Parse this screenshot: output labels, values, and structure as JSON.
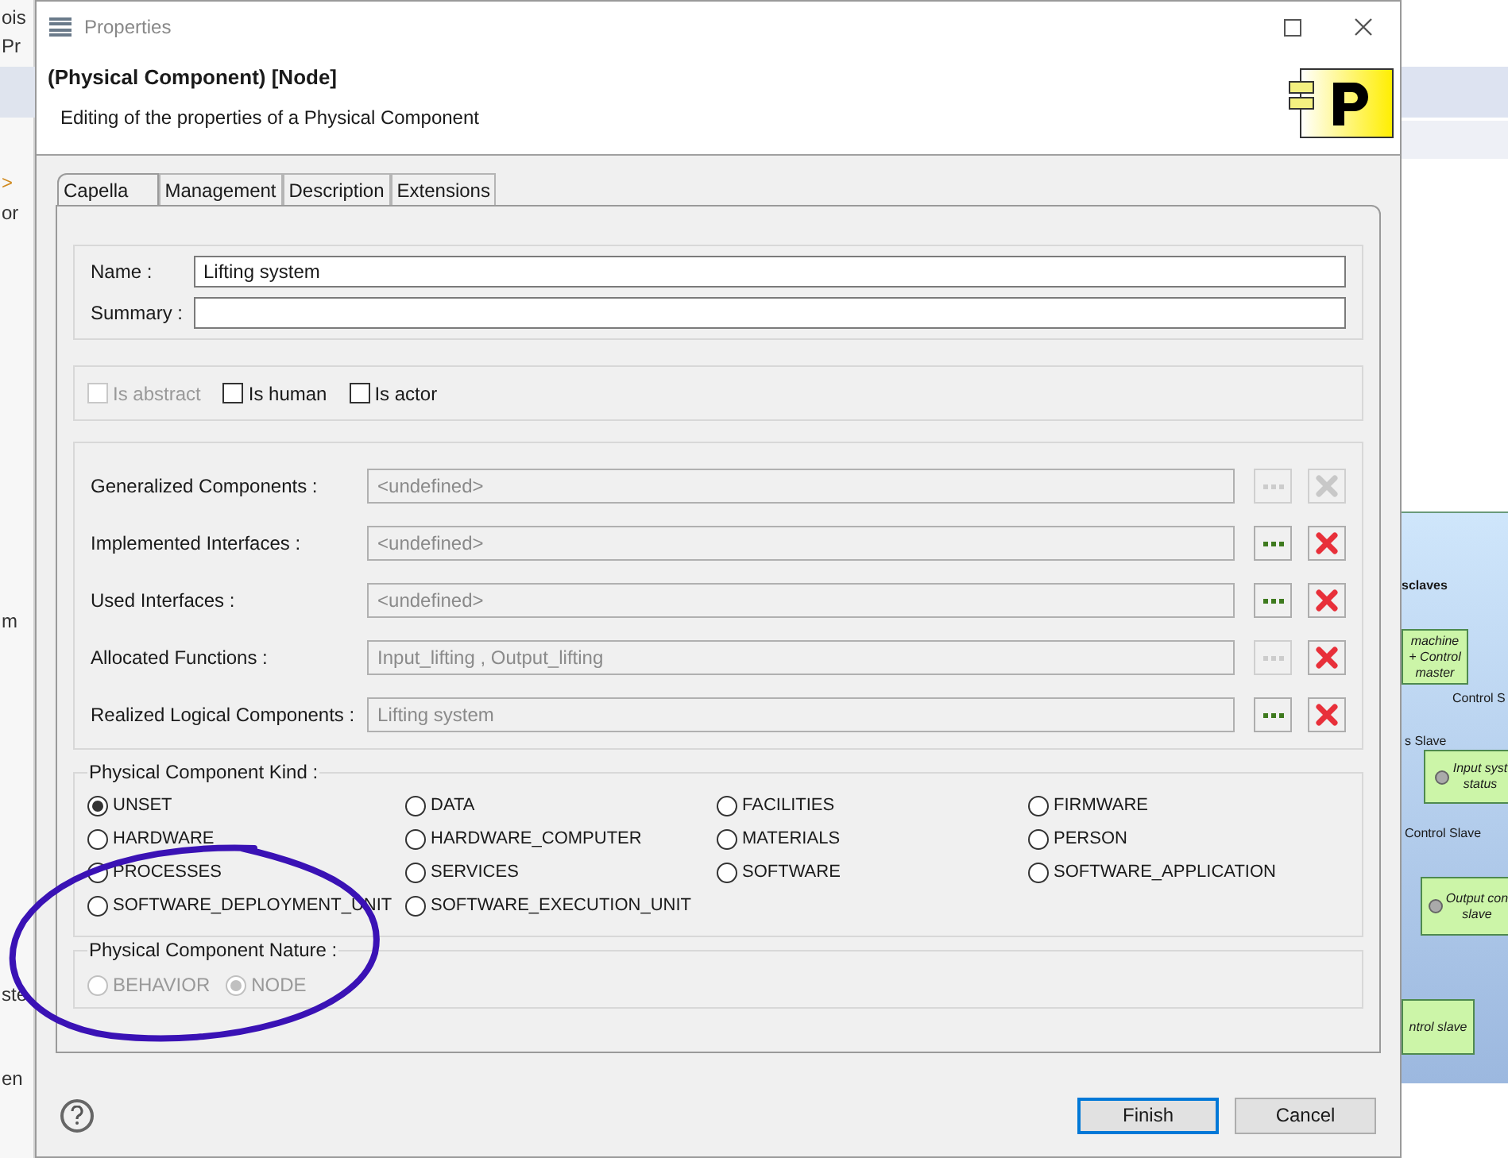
{
  "background_app": {
    "left_fragments": [
      "ois",
      "Pr",
      ">",
      "or",
      "m",
      "ste",
      "en"
    ],
    "diagram": {
      "container_title": "sclaves",
      "nodes": [
        {
          "lines": [
            "machine",
            "+ Control",
            "master"
          ],
          "kind": "plain"
        },
        {
          "lines": [
            "Input syst",
            "status"
          ],
          "kind": "function"
        },
        {
          "lines": [
            "Output con",
            "slave"
          ],
          "kind": "function"
        },
        {
          "lines": [
            "ntrol slave"
          ],
          "kind": "plain"
        }
      ],
      "labels": [
        "Control S",
        "s Slave",
        "Control Slave"
      ]
    }
  },
  "dialog": {
    "title": "Properties",
    "header_title": "(Physical Component) [Node]",
    "header_subtitle": "Editing of the properties of a Physical Component",
    "tabs": [
      {
        "label": "Capella",
        "selected": true
      },
      {
        "label": "Management",
        "selected": false
      },
      {
        "label": "Description",
        "selected": false
      },
      {
        "label": "Extensions",
        "selected": false
      }
    ],
    "fields": [
      {
        "label": "Name :",
        "value": "Lifting system"
      },
      {
        "label": "Summary :"
      }
    ],
    "flags": [
      {
        "label": "Is abstract",
        "checked": false,
        "disabled": true
      },
      {
        "label": "Is human",
        "checked": false,
        "disabled": false
      },
      {
        "label": "Is actor",
        "checked": false,
        "disabled": false
      }
    ],
    "references": [
      {
        "label": "Generalized Components :",
        "value": "<undefined>",
        "browse_enabled": false,
        "remove_enabled": false
      },
      {
        "label": "Implemented Interfaces :",
        "value": "<undefined>",
        "browse_enabled": true,
        "remove_enabled": true
      },
      {
        "label": "Used Interfaces :",
        "value": "<undefined>",
        "browse_enabled": true,
        "remove_enabled": true
      },
      {
        "label": "Allocated Functions :",
        "value": "Input_lifting , Output_lifting",
        "browse_enabled": false,
        "remove_enabled": true
      },
      {
        "label": "Realized Logical Components :",
        "value": "Lifting system",
        "browse_enabled": true,
        "remove_enabled": true
      }
    ],
    "kind_group": {
      "title": "Physical Component Kind :",
      "options": [
        {
          "label": "UNSET",
          "selected": true
        },
        {
          "label": "DATA",
          "selected": false
        },
        {
          "label": "FACILITIES",
          "selected": false
        },
        {
          "label": "FIRMWARE",
          "selected": false
        },
        {
          "label": "HARDWARE",
          "selected": false
        },
        {
          "label": "HARDWARE_COMPUTER",
          "selected": false
        },
        {
          "label": "MATERIALS",
          "selected": false
        },
        {
          "label": "PERSON",
          "selected": false
        },
        {
          "label": "PROCESSES",
          "selected": false
        },
        {
          "label": "SERVICES",
          "selected": false
        },
        {
          "label": "SOFTWARE",
          "selected": false
        },
        {
          "label": "SOFTWARE_APPLICATION",
          "selected": false
        },
        {
          "label": "SOFTWARE_DEPLOYMENT_UNIT",
          "selected": false
        },
        {
          "label": "SOFTWARE_EXECUTION_UNIT",
          "selected": false
        }
      ]
    },
    "nature_group": {
      "title": "Physical Component Nature :",
      "disabled": true,
      "options": [
        {
          "label": "BEHAVIOR",
          "selected": false
        },
        {
          "label": "NODE",
          "selected": true
        }
      ]
    },
    "buttons": [
      {
        "label": "Finish",
        "default": true
      },
      {
        "label": "Cancel",
        "default": false
      }
    ]
  }
}
